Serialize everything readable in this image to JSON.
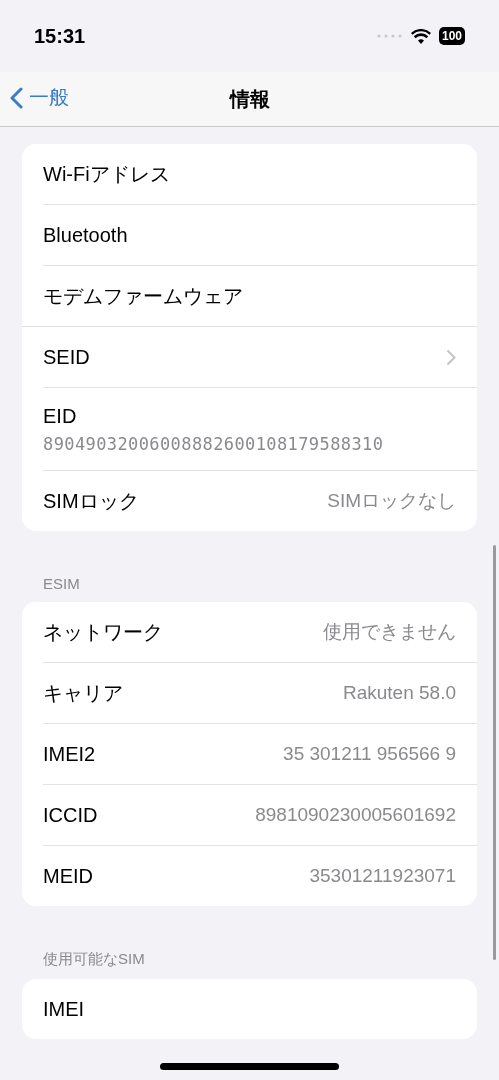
{
  "status_bar": {
    "time": "15:31",
    "battery": "100"
  },
  "nav": {
    "back": "一般",
    "title": "情報"
  },
  "groups": [
    {
      "rows": [
        {
          "kind": "plain",
          "label": "Wi-Fiアドレス"
        },
        {
          "kind": "plain",
          "label": "Bluetooth"
        },
        {
          "kind": "plain",
          "label": "モデムファームウェア"
        },
        {
          "kind": "chevron",
          "label": "SEID"
        },
        {
          "kind": "stacked",
          "label": "EID",
          "value": "89049032006008882600108179588310"
        },
        {
          "kind": "value",
          "label": "SIMロック",
          "value": "SIMロックなし"
        }
      ]
    },
    {
      "header": "ESIM",
      "rows": [
        {
          "kind": "value",
          "label": "ネットワーク",
          "value": "使用できません"
        },
        {
          "kind": "value",
          "label": "キャリア",
          "value": "Rakuten 58.0"
        },
        {
          "kind": "value",
          "label": "IMEI2",
          "value": "35 301211 956566 9"
        },
        {
          "kind": "value",
          "label": "ICCID",
          "value": "8981090230005601692"
        },
        {
          "kind": "value",
          "label": "MEID",
          "value": "35301211923071"
        }
      ]
    },
    {
      "header": "使用可能なSIM",
      "rows": [
        {
          "kind": "plain",
          "label": "IMEI"
        }
      ]
    }
  ]
}
